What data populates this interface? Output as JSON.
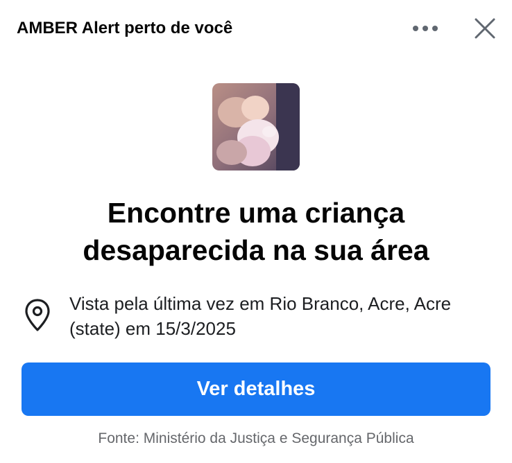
{
  "header": {
    "title": "AMBER Alert perto de você",
    "more_icon": "more-horizontal-icon",
    "close_icon": "close-icon"
  },
  "alert": {
    "photo": "baby-photo",
    "headline_line1": "Encontre uma criança",
    "headline_line2": "desaparecida na sua área",
    "location_icon": "location-pin-icon",
    "location_line1": "Vista pela última vez em Rio Branco, Acre, Acre",
    "location_line2": "(state) em 15/3/2025"
  },
  "actions": {
    "details_label": "Ver detalhes"
  },
  "footer": {
    "source": "Fonte: Ministério da Justiça e Segurança Pública"
  },
  "colors": {
    "primary_button": "#1877f2",
    "text_primary": "#050505",
    "text_secondary": "#65676b",
    "icon": "#606770"
  }
}
